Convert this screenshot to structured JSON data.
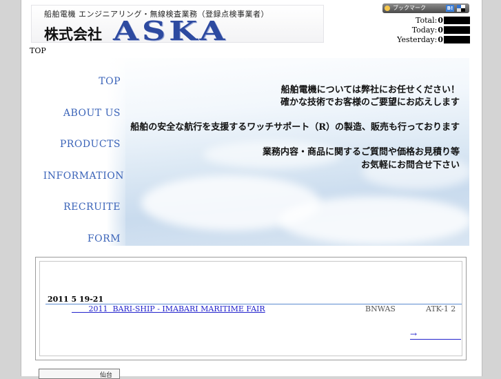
{
  "header": {
    "logo_subtitle": "船舶電機 エンジニアリング・無線検査業務（登録点検事業者）",
    "logo_corp": "株式会社",
    "logo_name": "ASKA"
  },
  "bookmark": {
    "label": "ブックマーク",
    "hatena_label": "B!",
    "icons": [
      "bookmark-icon",
      "hatena-icon",
      "delicious-icon"
    ]
  },
  "counters": [
    {
      "label": "Total:",
      "value": "0"
    },
    {
      "label": "Today:",
      "value": "0"
    },
    {
      "label": "Yesterday:",
      "value": "0"
    }
  ],
  "breadcrumb": "TOP",
  "nav": [
    {
      "label": "TOP"
    },
    {
      "label": "ABOUT US"
    },
    {
      "label": "PRODUCTS"
    },
    {
      "label": "INFORMATION"
    },
    {
      "label": "RECRUITE"
    },
    {
      "label": "FORM"
    }
  ],
  "hero": {
    "lines": [
      "船舶電機については弊社にお任せください！",
      "確かな技術でお客様のご要望にお応えします",
      "船舶の安全な航行を支援するワッチサポート（R）の製造、販売も行っております",
      "業務内容・商品に関するご質問や価格お見積り等",
      "お気軽にお問合せ下さい"
    ]
  },
  "news": {
    "date": "2011  5  19-21",
    "link_text": "       2011  BARI-SHIP - IMABARI MARITIME FAIR",
    "tag1": "BNWAS",
    "tag2": "ATK-1  2",
    "more": "→"
  },
  "banner": {
    "text": "仙台"
  },
  "colors": {
    "nav_text": "#3a63b8",
    "logo_text": "#2d4aa0",
    "link": "#2222cc",
    "rule": "#5b8ad0"
  }
}
